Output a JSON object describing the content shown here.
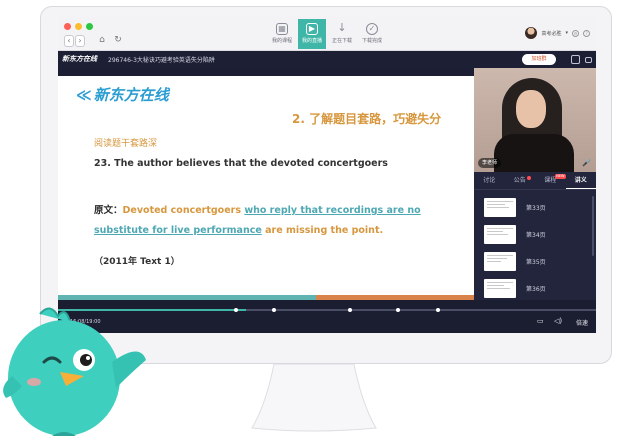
{
  "titlebar": {
    "nav_back": "‹",
    "nav_forward": "›",
    "tabs": [
      {
        "label": "我的课程",
        "icon": "grid-icon",
        "glyph": "▦"
      },
      {
        "label": "我的直播",
        "icon": "live-icon",
        "glyph": "▶"
      },
      {
        "label": "正在下载",
        "icon": "download-icon",
        "glyph": "↓"
      },
      {
        "label": "下载完成",
        "icon": "check-circle-icon",
        "glyph": "✓"
      }
    ],
    "user_name": "高考必胜",
    "caret": "▾"
  },
  "coursebar": {
    "logo_text": "新东方在线",
    "course_title": "296746-3大秘诀巧避考验英语失分陷阱",
    "join_button": "加班群"
  },
  "slide": {
    "logo_text": "新东方在线",
    "heading": "2. 了解题目套路，巧避失分",
    "subheading": "阅读题干套路深",
    "question": "23. The author believes that the devoted concertgoers",
    "original_label": "原文：",
    "original_part1": "Devoted concertgoers",
    "original_part2": "who reply that recordings are no substitute for live performance",
    "original_part3": "are missing the point.",
    "source": "（2011年 Text 1）"
  },
  "video": {
    "teacher_label": "李老师"
  },
  "panel": {
    "tabs": [
      "讨论",
      "公告",
      "课程",
      "讲义"
    ],
    "active_tab": "讲义",
    "new_badge": "NEW",
    "pages": [
      "第33页",
      "第34页",
      "第35页",
      "第36页"
    ]
  },
  "controls": {
    "time": "16:08/19:00",
    "progress": 0.35,
    "speed_label": "倍速"
  },
  "colors": {
    "accent": "#3fb6a8",
    "orange": "#d7973e",
    "dark_bg": "#1c1e33"
  }
}
